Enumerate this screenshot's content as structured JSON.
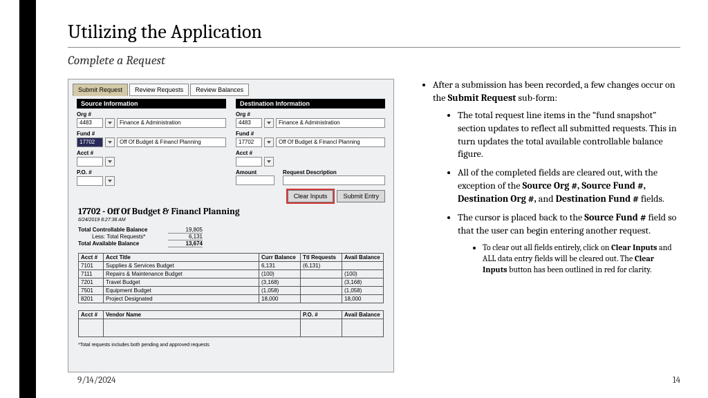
{
  "bar": "",
  "page_title": "Utilizing the Application",
  "subtitle": "Complete a Request",
  "footer": {
    "date": "9/14/2024",
    "page": "14"
  },
  "tabs": [
    "Submit Request",
    "Review Requests",
    "Review Balances"
  ],
  "sect": {
    "source": "Source Information",
    "dest": "Destination Information"
  },
  "labels": {
    "org": "Org #",
    "fund": "Fund #",
    "acct": "Acct #",
    "po": "P.O. #",
    "amount": "Amount",
    "reqdesc": "Request Description"
  },
  "src": {
    "org": "4483",
    "org_name": "Finance & Administration",
    "fund": "17702",
    "fund_name": "Off Of Budget & Financl Planning"
  },
  "dst": {
    "org": "4483",
    "org_name": "Finance & Administration",
    "fund": "17702",
    "fund_name": "Off Of Budget & Financl Planning"
  },
  "buttons": {
    "clear": "Clear Inputs",
    "submit": "Submit Entry"
  },
  "snapshot": {
    "title": "17702 - Off Of Budget & Financl Planning",
    "timestamp": "6/24/2019 8:27:38 AM",
    "total_ctrl_lbl": "Total Controllable Balance",
    "total_ctrl": "19,805",
    "less_lbl": "Less: Total Requests*",
    "less": "6,131",
    "avail_lbl": "Total Available Balance",
    "avail": "13,674",
    "cols": [
      "Acct #",
      "Acct Title",
      "Curr Balance",
      "Ttl Requests",
      "Avail Balance"
    ],
    "rows": [
      [
        "7101",
        "Supplies & Services Budget",
        "6,131",
        "(6,131)",
        ""
      ],
      [
        "7111",
        "Repairs & Maintenance Budget",
        "(100)",
        "",
        "(100)"
      ],
      [
        "7201",
        "Travel Budget",
        "(3,168)",
        "",
        "(3,168)"
      ],
      [
        "7501",
        "Equipment Budget",
        "(1,058)",
        "",
        "(1,058)"
      ],
      [
        "8201",
        "Project Designated",
        "18,000",
        "",
        "18,000"
      ]
    ],
    "vcols": [
      "Acct #",
      "Vendor Name",
      "P.O. #",
      "Avail Balance"
    ],
    "footnote": "*Total requests includes both pending and approved requests"
  },
  "text": {
    "lead": "After a submission has been recorded, a few changes occur on the ",
    "lead_b": "Submit Request",
    "lead2": " sub-form:",
    "b1": "The total request line items in the “fund snapshot” section updates to reflect all submitted requests. This in turn updates the total available controllable balance figure.",
    "b2a": "All of the completed fields are cleared out, with the exception of the ",
    "b2b": "Source Org #, Source Fund #, Destination Org #,",
    "b2c": " and ",
    "b2d": "Destination Fund #",
    "b2e": " fields.",
    "b3a": "The cursor is placed back to the ",
    "b3b": "Source Fund #",
    "b3c": " field so that the user can begin entering another request.",
    "b3s1a": "To clear out all fields entirely, click on ",
    "b3s1b": "Clear Inputs",
    "b3s1c": " and ALL data entry fields will be cleared out. The ",
    "b3s1d": "Clear Inputs",
    "b3s1e": " button has been outlined in red for clarity."
  }
}
